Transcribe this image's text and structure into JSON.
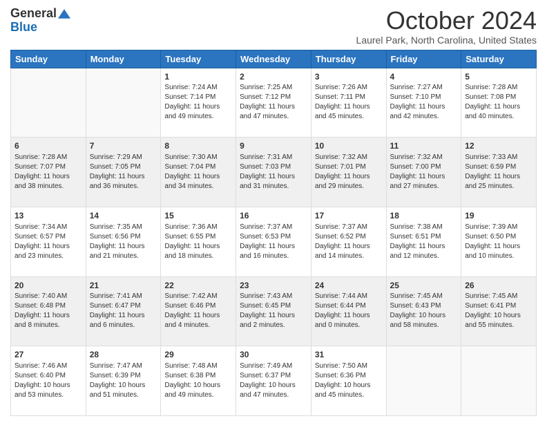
{
  "header": {
    "logo_general": "General",
    "logo_blue": "Blue",
    "month_title": "October 2024",
    "location": "Laurel Park, North Carolina, United States"
  },
  "days_of_week": [
    "Sunday",
    "Monday",
    "Tuesday",
    "Wednesday",
    "Thursday",
    "Friday",
    "Saturday"
  ],
  "weeks": [
    [
      {
        "day": "",
        "sunrise": "",
        "sunset": "",
        "daylight": "",
        "empty": true
      },
      {
        "day": "",
        "sunrise": "",
        "sunset": "",
        "daylight": "",
        "empty": true
      },
      {
        "day": "1",
        "sunrise": "Sunrise: 7:24 AM",
        "sunset": "Sunset: 7:14 PM",
        "daylight": "Daylight: 11 hours and 49 minutes."
      },
      {
        "day": "2",
        "sunrise": "Sunrise: 7:25 AM",
        "sunset": "Sunset: 7:12 PM",
        "daylight": "Daylight: 11 hours and 47 minutes."
      },
      {
        "day": "3",
        "sunrise": "Sunrise: 7:26 AM",
        "sunset": "Sunset: 7:11 PM",
        "daylight": "Daylight: 11 hours and 45 minutes."
      },
      {
        "day": "4",
        "sunrise": "Sunrise: 7:27 AM",
        "sunset": "Sunset: 7:10 PM",
        "daylight": "Daylight: 11 hours and 42 minutes."
      },
      {
        "day": "5",
        "sunrise": "Sunrise: 7:28 AM",
        "sunset": "Sunset: 7:08 PM",
        "daylight": "Daylight: 11 hours and 40 minutes."
      }
    ],
    [
      {
        "day": "6",
        "sunrise": "Sunrise: 7:28 AM",
        "sunset": "Sunset: 7:07 PM",
        "daylight": "Daylight: 11 hours and 38 minutes."
      },
      {
        "day": "7",
        "sunrise": "Sunrise: 7:29 AM",
        "sunset": "Sunset: 7:05 PM",
        "daylight": "Daylight: 11 hours and 36 minutes."
      },
      {
        "day": "8",
        "sunrise": "Sunrise: 7:30 AM",
        "sunset": "Sunset: 7:04 PM",
        "daylight": "Daylight: 11 hours and 34 minutes."
      },
      {
        "day": "9",
        "sunrise": "Sunrise: 7:31 AM",
        "sunset": "Sunset: 7:03 PM",
        "daylight": "Daylight: 11 hours and 31 minutes."
      },
      {
        "day": "10",
        "sunrise": "Sunrise: 7:32 AM",
        "sunset": "Sunset: 7:01 PM",
        "daylight": "Daylight: 11 hours and 29 minutes."
      },
      {
        "day": "11",
        "sunrise": "Sunrise: 7:32 AM",
        "sunset": "Sunset: 7:00 PM",
        "daylight": "Daylight: 11 hours and 27 minutes."
      },
      {
        "day": "12",
        "sunrise": "Sunrise: 7:33 AM",
        "sunset": "Sunset: 6:59 PM",
        "daylight": "Daylight: 11 hours and 25 minutes."
      }
    ],
    [
      {
        "day": "13",
        "sunrise": "Sunrise: 7:34 AM",
        "sunset": "Sunset: 6:57 PM",
        "daylight": "Daylight: 11 hours and 23 minutes."
      },
      {
        "day": "14",
        "sunrise": "Sunrise: 7:35 AM",
        "sunset": "Sunset: 6:56 PM",
        "daylight": "Daylight: 11 hours and 21 minutes."
      },
      {
        "day": "15",
        "sunrise": "Sunrise: 7:36 AM",
        "sunset": "Sunset: 6:55 PM",
        "daylight": "Daylight: 11 hours and 18 minutes."
      },
      {
        "day": "16",
        "sunrise": "Sunrise: 7:37 AM",
        "sunset": "Sunset: 6:53 PM",
        "daylight": "Daylight: 11 hours and 16 minutes."
      },
      {
        "day": "17",
        "sunrise": "Sunrise: 7:37 AM",
        "sunset": "Sunset: 6:52 PM",
        "daylight": "Daylight: 11 hours and 14 minutes."
      },
      {
        "day": "18",
        "sunrise": "Sunrise: 7:38 AM",
        "sunset": "Sunset: 6:51 PM",
        "daylight": "Daylight: 11 hours and 12 minutes."
      },
      {
        "day": "19",
        "sunrise": "Sunrise: 7:39 AM",
        "sunset": "Sunset: 6:50 PM",
        "daylight": "Daylight: 11 hours and 10 minutes."
      }
    ],
    [
      {
        "day": "20",
        "sunrise": "Sunrise: 7:40 AM",
        "sunset": "Sunset: 6:48 PM",
        "daylight": "Daylight: 11 hours and 8 minutes."
      },
      {
        "day": "21",
        "sunrise": "Sunrise: 7:41 AM",
        "sunset": "Sunset: 6:47 PM",
        "daylight": "Daylight: 11 hours and 6 minutes."
      },
      {
        "day": "22",
        "sunrise": "Sunrise: 7:42 AM",
        "sunset": "Sunset: 6:46 PM",
        "daylight": "Daylight: 11 hours and 4 minutes."
      },
      {
        "day": "23",
        "sunrise": "Sunrise: 7:43 AM",
        "sunset": "Sunset: 6:45 PM",
        "daylight": "Daylight: 11 hours and 2 minutes."
      },
      {
        "day": "24",
        "sunrise": "Sunrise: 7:44 AM",
        "sunset": "Sunset: 6:44 PM",
        "daylight": "Daylight: 11 hours and 0 minutes."
      },
      {
        "day": "25",
        "sunrise": "Sunrise: 7:45 AM",
        "sunset": "Sunset: 6:43 PM",
        "daylight": "Daylight: 10 hours and 58 minutes."
      },
      {
        "day": "26",
        "sunrise": "Sunrise: 7:45 AM",
        "sunset": "Sunset: 6:41 PM",
        "daylight": "Daylight: 10 hours and 55 minutes."
      }
    ],
    [
      {
        "day": "27",
        "sunrise": "Sunrise: 7:46 AM",
        "sunset": "Sunset: 6:40 PM",
        "daylight": "Daylight: 10 hours and 53 minutes."
      },
      {
        "day": "28",
        "sunrise": "Sunrise: 7:47 AM",
        "sunset": "Sunset: 6:39 PM",
        "daylight": "Daylight: 10 hours and 51 minutes."
      },
      {
        "day": "29",
        "sunrise": "Sunrise: 7:48 AM",
        "sunset": "Sunset: 6:38 PM",
        "daylight": "Daylight: 10 hours and 49 minutes."
      },
      {
        "day": "30",
        "sunrise": "Sunrise: 7:49 AM",
        "sunset": "Sunset: 6:37 PM",
        "daylight": "Daylight: 10 hours and 47 minutes."
      },
      {
        "day": "31",
        "sunrise": "Sunrise: 7:50 AM",
        "sunset": "Sunset: 6:36 PM",
        "daylight": "Daylight: 10 hours and 45 minutes."
      },
      {
        "day": "",
        "sunrise": "",
        "sunset": "",
        "daylight": "",
        "empty": true
      },
      {
        "day": "",
        "sunrise": "",
        "sunset": "",
        "daylight": "",
        "empty": true
      }
    ]
  ]
}
